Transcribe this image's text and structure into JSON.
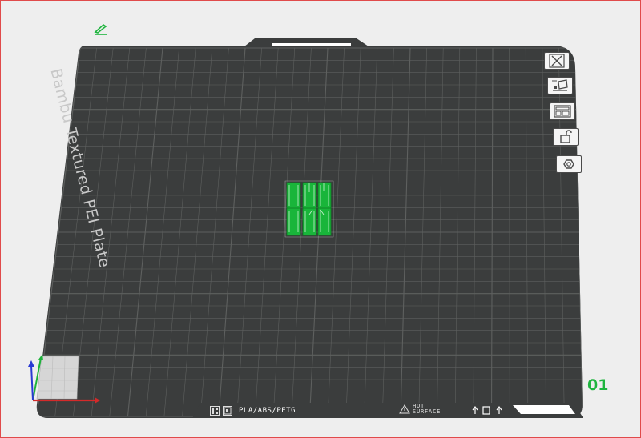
{
  "plate": {
    "name": "Bambu Textured PEI Plate",
    "material_label": "PLA/ABS/PETG",
    "warning_line1": "HOT",
    "warning_line2": "SURFACE",
    "plate_number": "01"
  },
  "toolbar": {
    "buttons": [
      {
        "name": "close-plate-button",
        "icon": "close-icon"
      },
      {
        "name": "auto-orient-button",
        "icon": "auto-orient-icon"
      },
      {
        "name": "arrange-button",
        "icon": "arrange-icon"
      },
      {
        "name": "lock-button",
        "icon": "unlock-icon"
      },
      {
        "name": "plate-settings-button",
        "icon": "hexagon-settings-icon"
      }
    ]
  },
  "colors": {
    "plate": "#3b3d3d",
    "grid": "#5e605f",
    "model": "#19b53a",
    "accent": "#1fb53f",
    "axis_x": "#d42a2a",
    "axis_y": "#1db33a",
    "axis_z": "#2a3ad4"
  }
}
